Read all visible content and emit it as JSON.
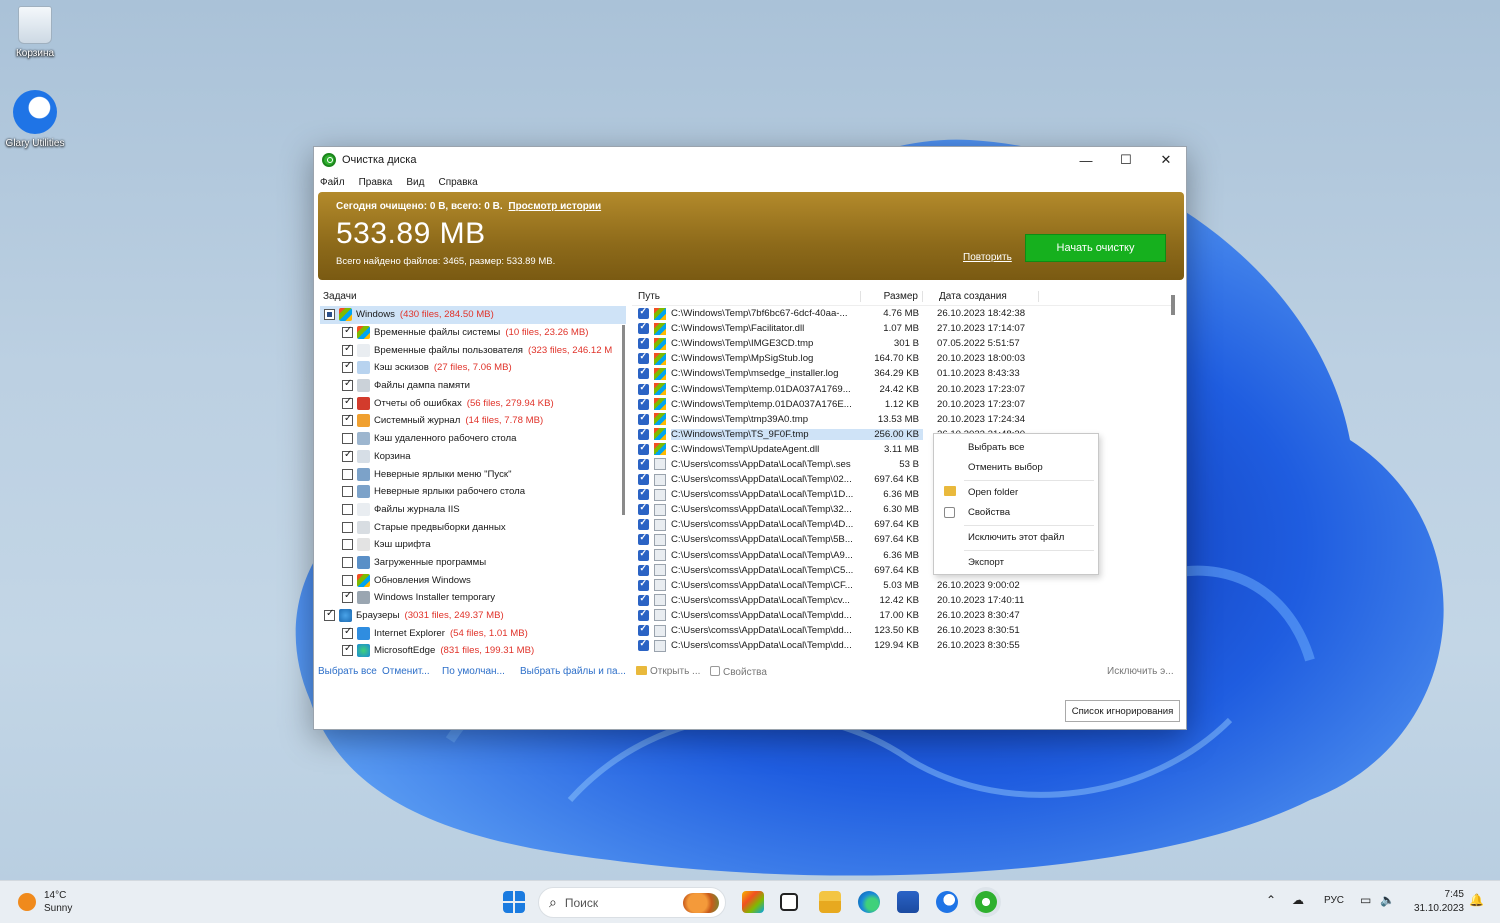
{
  "desktop": {
    "icons": [
      {
        "label": "Корзина"
      },
      {
        "label": "Glary Utilities"
      }
    ]
  },
  "window": {
    "title": "Очистка диска",
    "menu": [
      "Файл",
      "Правка",
      "Вид",
      "Справка"
    ],
    "banner": {
      "summary": "Сегодня очищено: 0 B, всего: 0 B.",
      "history_link": "Просмотр истории",
      "total_size": "533.89 MB",
      "found": "Всего найдено файлов: 3465, размер: 533.89 MB.",
      "repeat_link": "Повторить",
      "start_button": "Начать очистку"
    },
    "tasks": {
      "header": "Задачи",
      "items": [
        {
          "label": "Windows",
          "count": "(430 files, 284.50 MB)",
          "state": "part",
          "level": 0,
          "icon": "windows-icon",
          "selected": true
        },
        {
          "label": "Временные файлы системы",
          "count": "(10 files, 23.26 MB)",
          "state": "on",
          "level": 1,
          "icon": "windows-icon"
        },
        {
          "label": "Временные файлы пользователя",
          "count": "(323 files, 246.12 M",
          "state": "on",
          "level": 1,
          "icon": "file-icon"
        },
        {
          "label": "Кэш эскизов",
          "count": "(27 files, 7.06 MB)",
          "state": "on",
          "level": 1,
          "icon": "thumbnail-icon"
        },
        {
          "label": "Файлы дампа памяти",
          "count": "",
          "state": "on",
          "level": 1,
          "icon": "memory-icon"
        },
        {
          "label": "Отчеты об ошибках",
          "count": "(56 files, 279.94 KB)",
          "state": "on",
          "level": 1,
          "icon": "error-report-icon"
        },
        {
          "label": "Системный журнал",
          "count": "(14 files, 7.78 MB)",
          "state": "on",
          "level": 1,
          "icon": "log-icon"
        },
        {
          "label": "Кэш удаленного рабочего стола",
          "count": "",
          "state": "off",
          "level": 1,
          "icon": "remote-desktop-icon"
        },
        {
          "label": "Корзина",
          "count": "",
          "state": "on",
          "level": 1,
          "icon": "recycle-bin-icon"
        },
        {
          "label": "Неверные ярлыки меню \"Пуск\"",
          "count": "",
          "state": "off",
          "level": 1,
          "icon": "shortcut-icon"
        },
        {
          "label": "Неверные ярлыки рабочего стола",
          "count": "",
          "state": "off",
          "level": 1,
          "icon": "shortcut-icon"
        },
        {
          "label": "Файлы журнала IIS",
          "count": "",
          "state": "off",
          "level": 1,
          "icon": "file-icon"
        },
        {
          "label": "Старые предвыборки данных",
          "count": "",
          "state": "off",
          "level": 1,
          "icon": "prefetch-icon"
        },
        {
          "label": "Кэш шрифта",
          "count": "",
          "state": "off",
          "level": 1,
          "icon": "font-icon"
        },
        {
          "label": "Загруженные программы",
          "count": "",
          "state": "off",
          "level": 1,
          "icon": "program-icon"
        },
        {
          "label": "Обновления Windows",
          "count": "",
          "state": "off",
          "level": 1,
          "icon": "windows-icon"
        },
        {
          "label": "Windows Installer temporary",
          "count": "",
          "state": "on",
          "level": 1,
          "icon": "installer-icon"
        },
        {
          "label": "Браузеры",
          "count": "(3031 files, 249.37 MB)",
          "state": "on",
          "level": 0,
          "icon": "globe-icon"
        },
        {
          "label": "Internet Explorer",
          "count": "(54 files, 1.01 MB)",
          "state": "on",
          "level": 1,
          "icon": "ie-icon"
        },
        {
          "label": "MicrosoftEdge",
          "count": "(831 files, 199.31 MB)",
          "state": "on",
          "level": 1,
          "icon": "edge-icon"
        }
      ]
    },
    "files": {
      "columns": {
        "path": "Путь",
        "size": "Размер",
        "date": "Дата создания"
      },
      "rows": [
        {
          "path": "C:\\Windows\\Temp\\7bf6bc67-6dcf-40aa-...",
          "size": "4.76 MB",
          "date": "26.10.2023 18:42:38",
          "icon": "windows-icon"
        },
        {
          "path": "C:\\Windows\\Temp\\Facilitator.dll",
          "size": "1.07 MB",
          "date": "27.10.2023 17:14:07",
          "icon": "windows-icon"
        },
        {
          "path": "C:\\Windows\\Temp\\IMGE3CD.tmp",
          "size": "301 B",
          "date": "07.05.2022 5:51:57",
          "icon": "windows-icon"
        },
        {
          "path": "C:\\Windows\\Temp\\MpSigStub.log",
          "size": "164.70 KB",
          "date": "20.10.2023 18:00:03",
          "icon": "windows-icon"
        },
        {
          "path": "C:\\Windows\\Temp\\msedge_installer.log",
          "size": "364.29 KB",
          "date": "01.10.2023 8:43:33",
          "icon": "windows-icon"
        },
        {
          "path": "C:\\Windows\\Temp\\temp.01DA037A1769...",
          "size": "24.42 KB",
          "date": "20.10.2023 17:23:07",
          "icon": "windows-icon"
        },
        {
          "path": "C:\\Windows\\Temp\\temp.01DA037A176E...",
          "size": "1.12 KB",
          "date": "20.10.2023 17:23:07",
          "icon": "windows-icon"
        },
        {
          "path": "C:\\Windows\\Temp\\tmp39A0.tmp",
          "size": "13.53 MB",
          "date": "20.10.2023 17:24:34",
          "icon": "windows-icon"
        },
        {
          "path": "C:\\Windows\\Temp\\TS_9F0F.tmp",
          "size": "256.00 KB",
          "date": "26.10.2023 21:48:30",
          "icon": "windows-icon",
          "selected": true
        },
        {
          "path": "C:\\Windows\\Temp\\UpdateAgent.dll",
          "size": "3.11 MB",
          "date": "",
          "icon": "windows-icon"
        },
        {
          "path": "C:\\Users\\comss\\AppData\\Local\\Temp\\.ses",
          "size": "53 B",
          "date": "",
          "icon": "file-icon"
        },
        {
          "path": "C:\\Users\\comss\\AppData\\Local\\Temp\\02...",
          "size": "697.64 KB",
          "date": "",
          "icon": "file-icon"
        },
        {
          "path": "C:\\Users\\comss\\AppData\\Local\\Temp\\1D...",
          "size": "6.36 MB",
          "date": "",
          "icon": "file-icon"
        },
        {
          "path": "C:\\Users\\comss\\AppData\\Local\\Temp\\32...",
          "size": "6.30 MB",
          "date": "",
          "icon": "file-icon"
        },
        {
          "path": "C:\\Users\\comss\\AppData\\Local\\Temp\\4D...",
          "size": "697.64 KB",
          "date": "",
          "icon": "file-icon"
        },
        {
          "path": "C:\\Users\\comss\\AppData\\Local\\Temp\\5B...",
          "size": "697.64 KB",
          "date": "",
          "icon": "file-icon"
        },
        {
          "path": "C:\\Users\\comss\\AppData\\Local\\Temp\\A9...",
          "size": "6.36 MB",
          "date": "",
          "icon": "file-icon"
        },
        {
          "path": "C:\\Users\\comss\\AppData\\Local\\Temp\\C5...",
          "size": "697.64 KB",
          "date": "",
          "icon": "file-icon"
        },
        {
          "path": "C:\\Users\\comss\\AppData\\Local\\Temp\\CF...",
          "size": "5.03 MB",
          "date": "26.10.2023 9:00:02",
          "icon": "file-icon"
        },
        {
          "path": "C:\\Users\\comss\\AppData\\Local\\Temp\\cv...",
          "size": "12.42 KB",
          "date": "20.10.2023 17:40:11",
          "icon": "file-icon"
        },
        {
          "path": "C:\\Users\\comss\\AppData\\Local\\Temp\\dd...",
          "size": "17.00 KB",
          "date": "26.10.2023 8:30:47",
          "icon": "file-icon"
        },
        {
          "path": "C:\\Users\\comss\\AppData\\Local\\Temp\\dd...",
          "size": "123.50 KB",
          "date": "26.10.2023 8:30:51",
          "icon": "file-icon"
        },
        {
          "path": "C:\\Users\\comss\\AppData\\Local\\Temp\\dd...",
          "size": "129.94 KB",
          "date": "26.10.2023 8:30:55",
          "icon": "file-icon"
        }
      ]
    },
    "bottom_links": {
      "select_all": "Выбрать все",
      "cancel": "Отменит...",
      "default": "По умолчан...",
      "select_files": "Выбрать файлы и па...",
      "open": "Открыть ...",
      "properties": "Свойства",
      "exclude": "Исключить э..."
    },
    "ignore_list_button": "Список игнорирования"
  },
  "context_menu": {
    "items": [
      "Выбрать все",
      "Отменить выбор",
      "Open folder",
      "Свойства",
      "Исключить этот файл",
      "Экспорт"
    ]
  },
  "taskbar": {
    "weather_temp": "14°C",
    "weather_desc": "Sunny",
    "search_placeholder": "Поиск",
    "language": "РУС",
    "time": "7:45",
    "date": "31.10.2023"
  }
}
